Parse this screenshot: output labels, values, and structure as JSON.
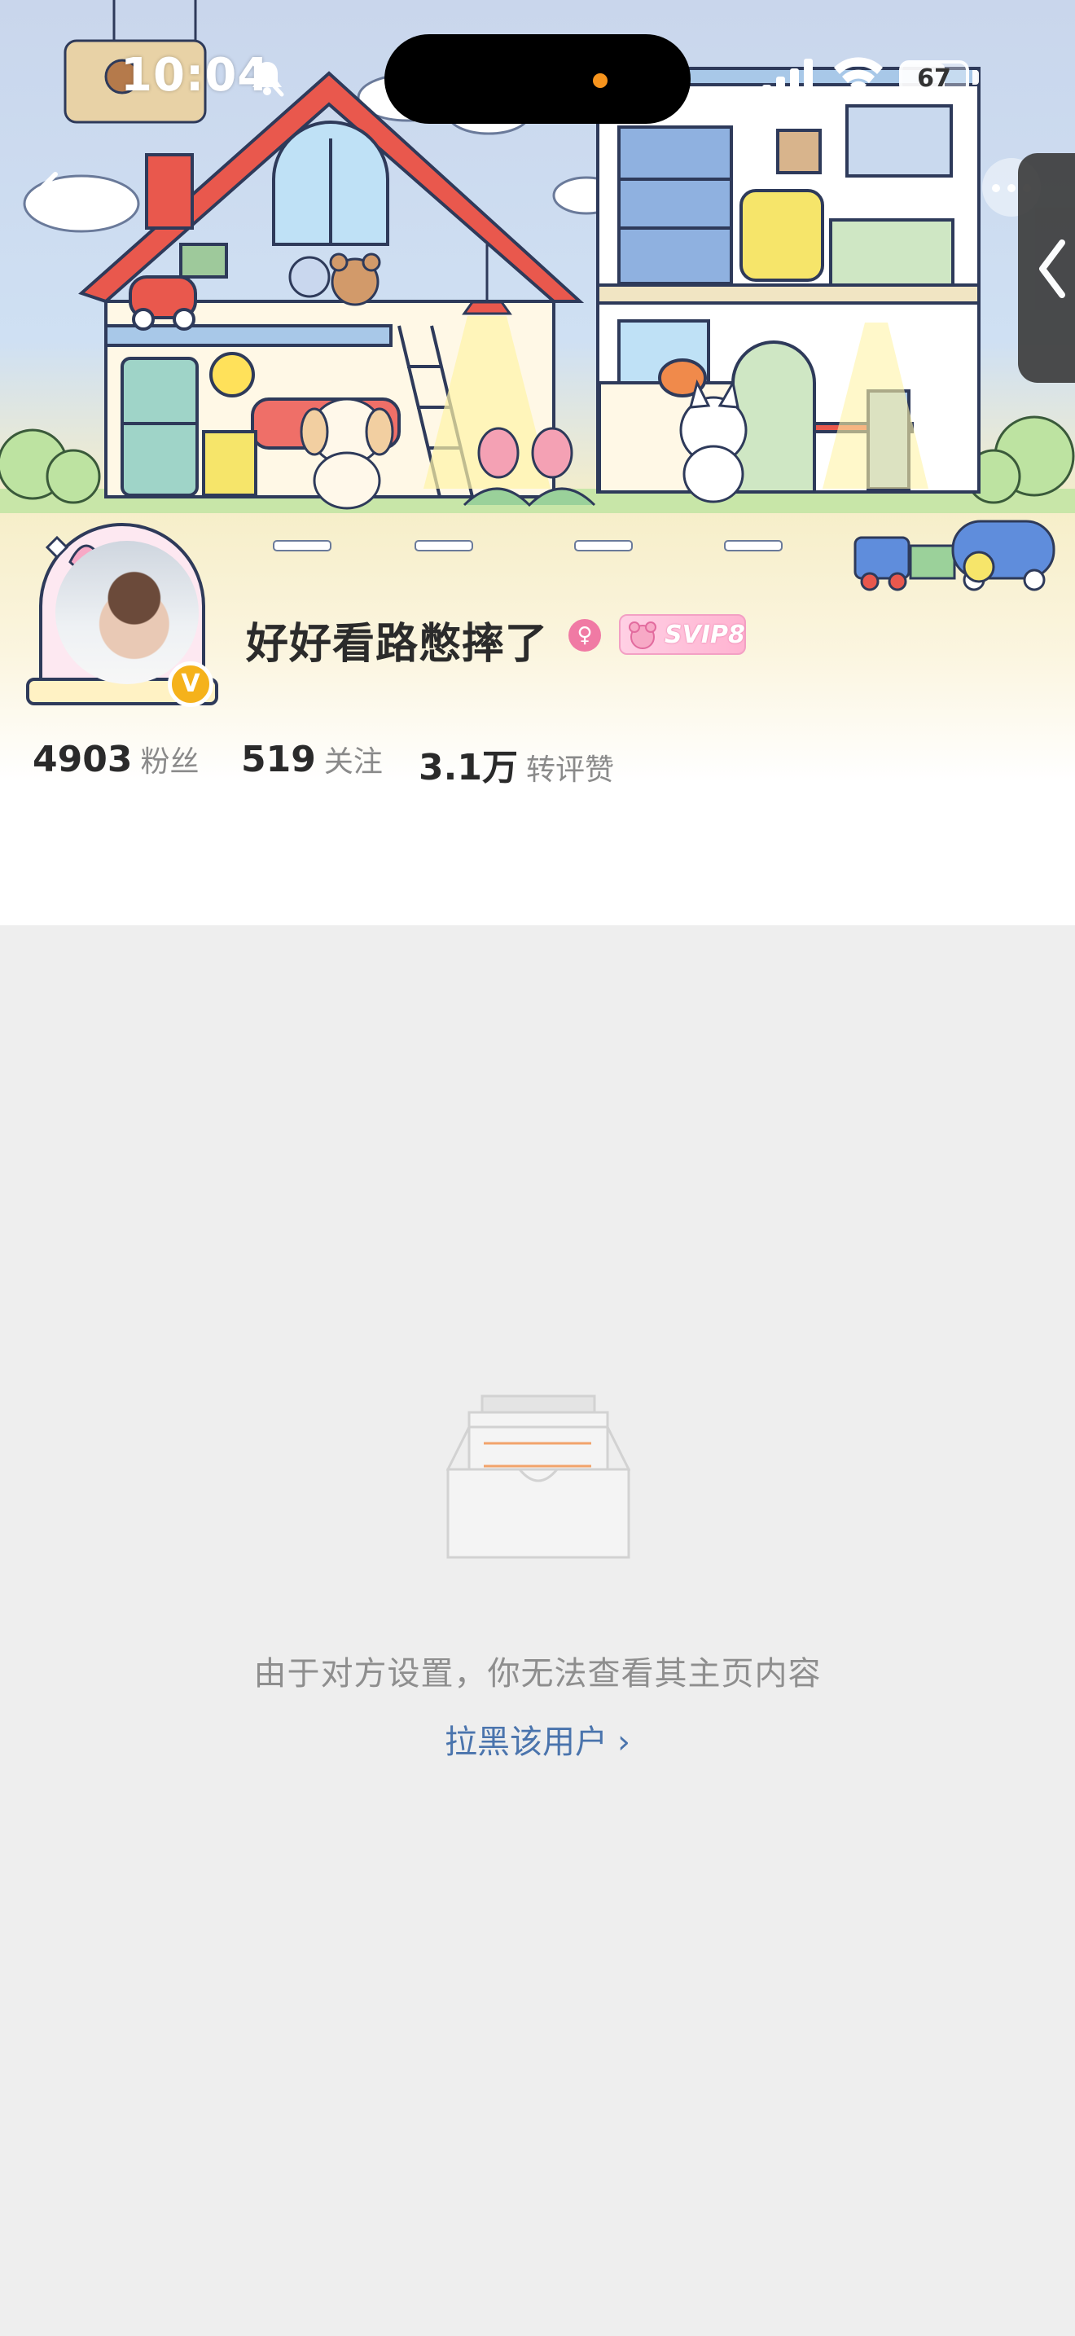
{
  "status_bar": {
    "time": "10:04",
    "battery_level": "67",
    "battery_fill_percent": 67,
    "icons": [
      "bell-off-icon",
      "signal-icon",
      "wifi-icon",
      "battery-icon"
    ]
  },
  "nav": {
    "back_icon": "chevron-left-icon",
    "more_icon": "more-dots-icon",
    "side_tab_icon": "chevron-left-icon"
  },
  "header": {
    "illustration": "cartoon-house-banner",
    "avatar_badge": "V",
    "username": "好好看路憋摔了",
    "gender_icon": "♀",
    "svip_label": "SVIP8"
  },
  "stats": [
    {
      "num": "4903",
      "label": "粉丝"
    },
    {
      "num": "519",
      "label": "关注"
    },
    {
      "num": "3.1万",
      "label": "转评赞"
    }
  ],
  "empty_state": {
    "icon": "empty-box-icon",
    "message": "由于对方设置，你无法查看其主页内容",
    "link": "拉黑该用户",
    "link_chevron": "›"
  },
  "colors": {
    "accent_link": "#4a74ad",
    "verified": "#f5b21b",
    "page_bg": "#eeeeee",
    "empty_icon_lines": "#f2a36b"
  }
}
